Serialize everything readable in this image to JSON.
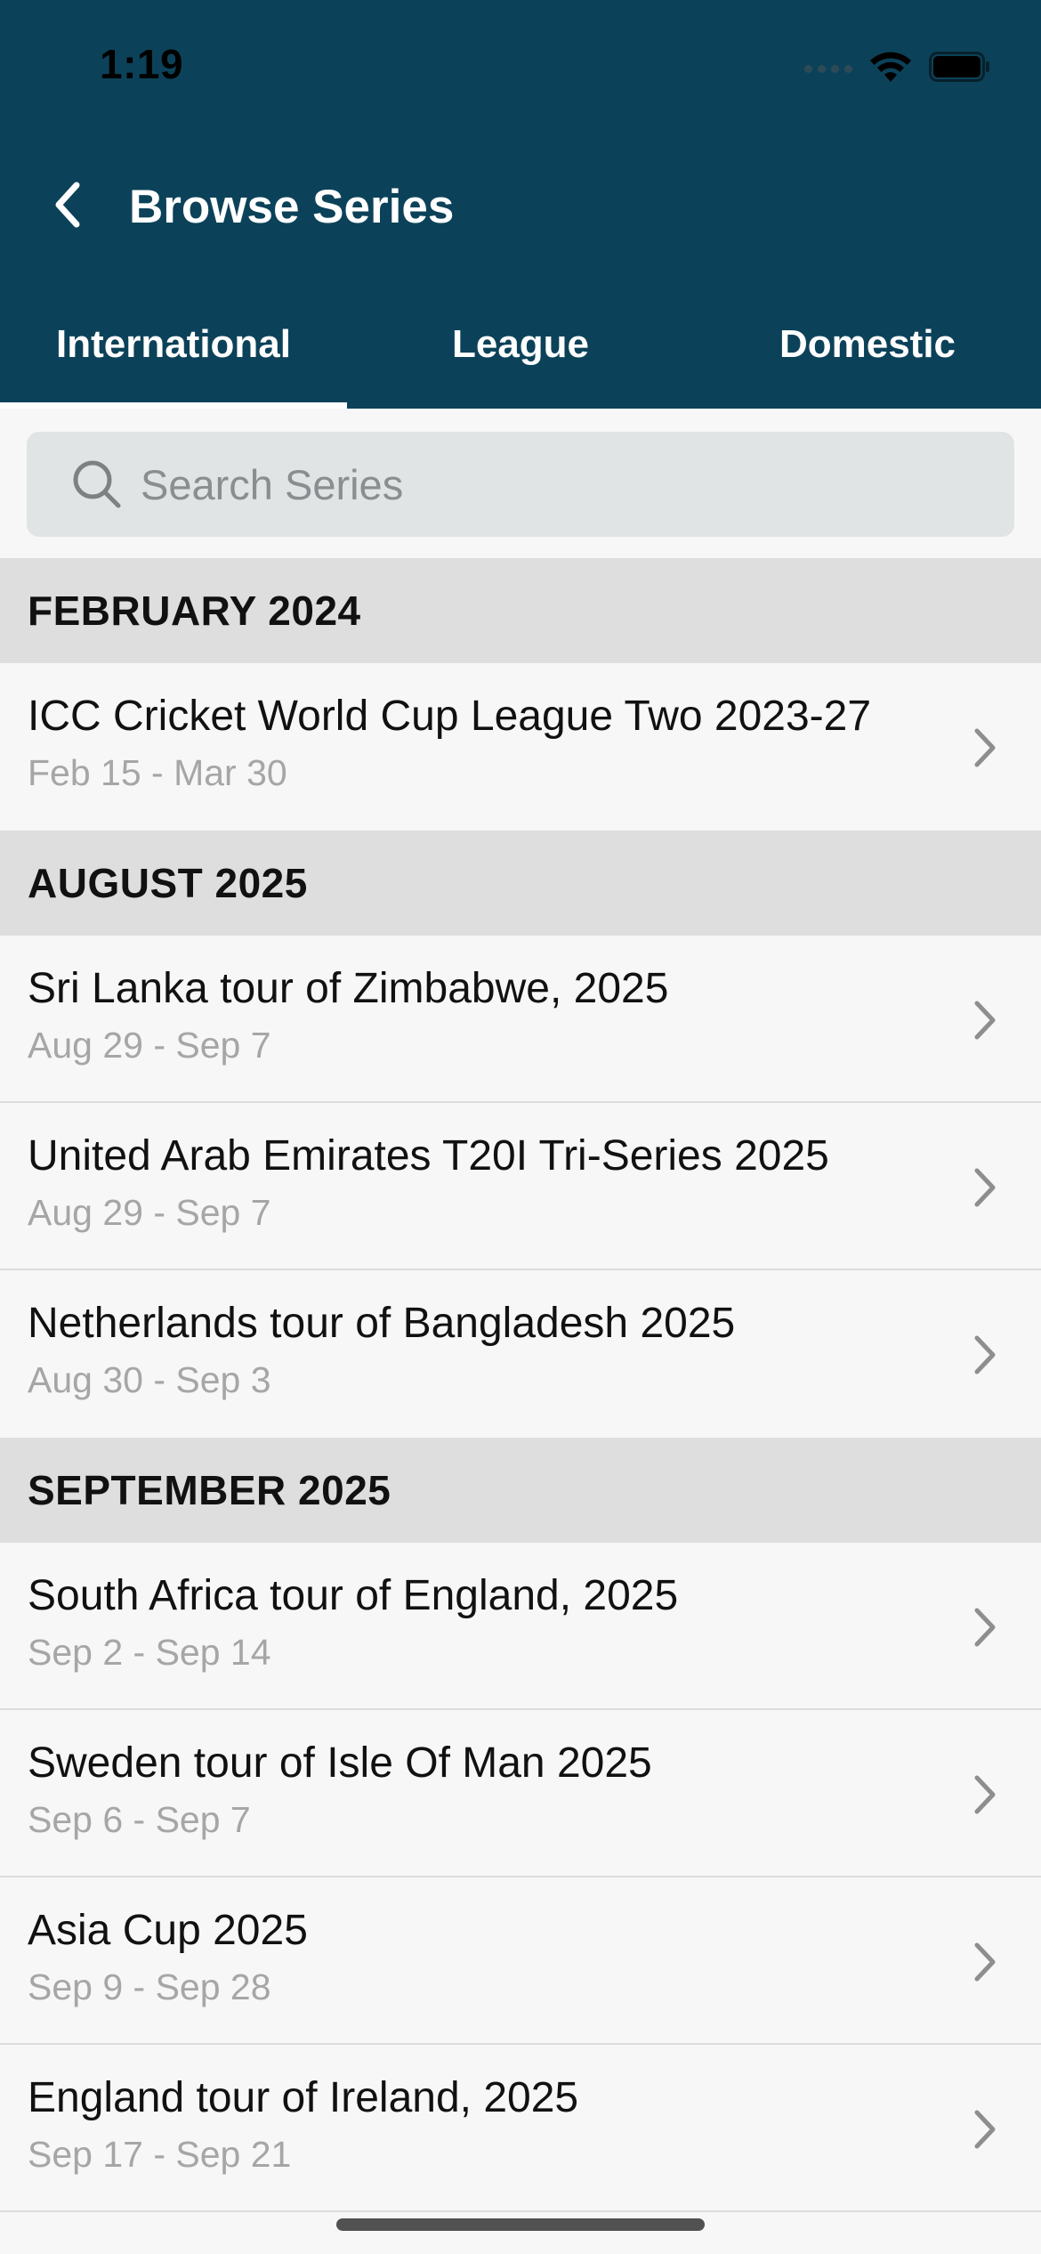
{
  "status_bar": {
    "time": "1:19"
  },
  "nav": {
    "title": "Browse Series",
    "back_icon": "chevron-left-icon"
  },
  "tabs": [
    {
      "label": "International",
      "active": true
    },
    {
      "label": "League",
      "active": false
    },
    {
      "label": "Domestic",
      "active": false
    }
  ],
  "search": {
    "placeholder": "Search Series",
    "value": "",
    "icon": "search-icon"
  },
  "sections": [
    {
      "title": "FEBRUARY 2024",
      "items": [
        {
          "title": "ICC Cricket World Cup League Two 2023-27",
          "dates": "Feb 15 - Mar 30"
        }
      ]
    },
    {
      "title": "AUGUST 2025",
      "items": [
        {
          "title": "Sri Lanka tour of Zimbabwe, 2025",
          "dates": "Aug 29 - Sep 7"
        },
        {
          "title": "United Arab Emirates T20I Tri-Series 2025",
          "dates": "Aug 29 - Sep 7"
        },
        {
          "title": "Netherlands tour of Bangladesh 2025",
          "dates": "Aug 30 - Sep 3"
        }
      ]
    },
    {
      "title": "SEPTEMBER 2025",
      "items": [
        {
          "title": "South Africa tour of England, 2025",
          "dates": "Sep 2 - Sep 14"
        },
        {
          "title": "Sweden tour of Isle Of Man 2025",
          "dates": "Sep 6 - Sep 7"
        },
        {
          "title": "Asia Cup 2025",
          "dates": "Sep 9 - Sep 28"
        },
        {
          "title": "England tour of Ireland, 2025",
          "dates": "Sep 17 - Sep 21"
        }
      ]
    }
  ],
  "colors": {
    "header_bg": "#0c4259",
    "section_bg": "#dedede",
    "list_bg": "#f7f7f7",
    "search_bg": "#e0e4e4",
    "subtitle": "#a6a6a6"
  }
}
